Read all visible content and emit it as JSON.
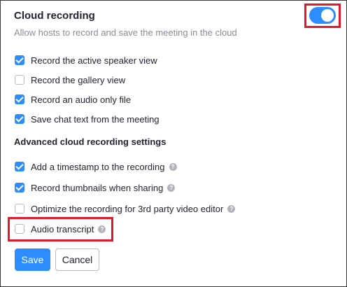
{
  "header": {
    "title": "Cloud recording",
    "subtitle": "Allow hosts to record and save the meeting in the cloud",
    "toggle_on": true
  },
  "options": [
    {
      "label": "Record the active speaker view",
      "checked": true
    },
    {
      "label": "Record the gallery view",
      "checked": false
    },
    {
      "label": "Record an audio only file",
      "checked": true
    },
    {
      "label": "Save chat text from the meeting",
      "checked": true
    }
  ],
  "advanced": {
    "heading": "Advanced cloud recording settings",
    "options": [
      {
        "label": "Add a timestamp to the recording",
        "checked": true,
        "help": true
      },
      {
        "label": "Record thumbnails when sharing",
        "checked": true,
        "help": true
      },
      {
        "label": "Optimize the recording for 3rd party video editor",
        "checked": false,
        "help": true
      },
      {
        "label": "Audio transcript",
        "checked": false,
        "help": true
      }
    ]
  },
  "help_icon_glyph": "?",
  "buttons": {
    "save": "Save",
    "cancel": "Cancel"
  },
  "colors": {
    "accent": "#2d8cff",
    "highlight": "#e0192d"
  }
}
